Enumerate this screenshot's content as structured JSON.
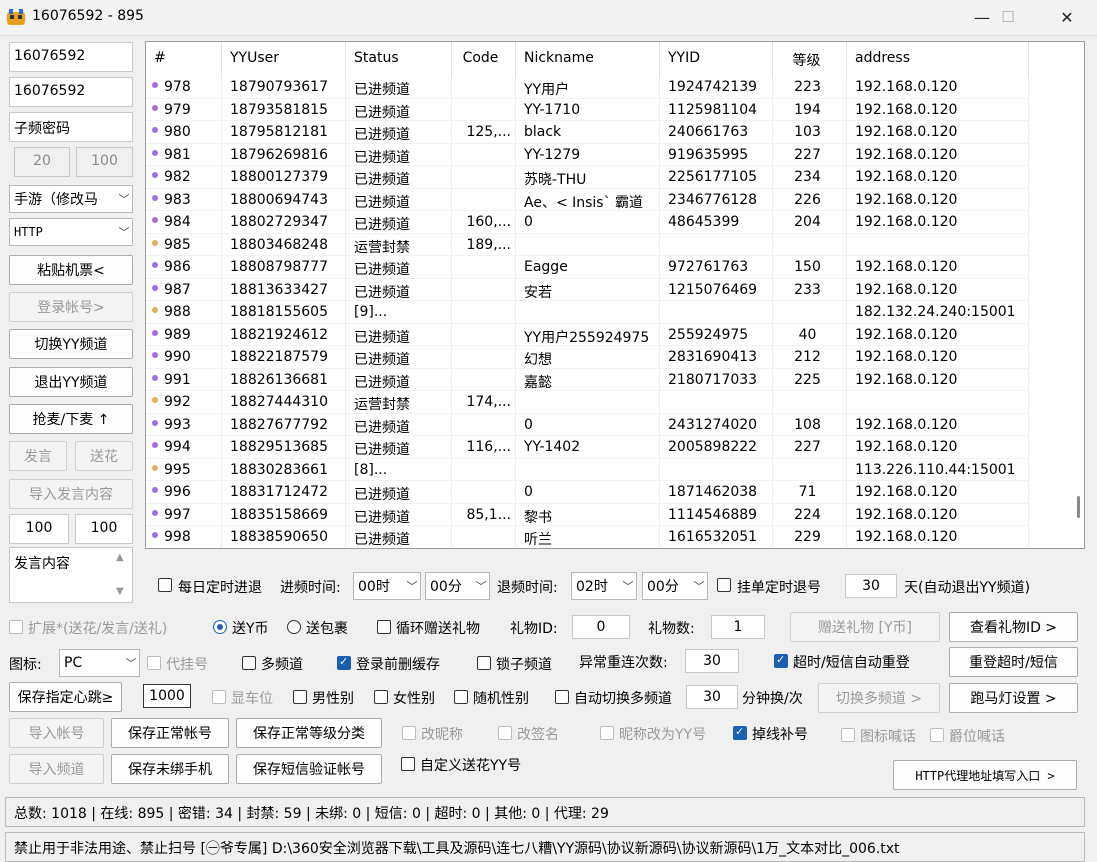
{
  "window": {
    "title": "16076592 - 895",
    "minimize": "—",
    "maximize": "☐",
    "close": "✕"
  },
  "left": {
    "field1": "16076592",
    "field2": "16076592",
    "subpwd": "子频密码",
    "n20": "20",
    "n100": "100",
    "game_select": "手游（修改马",
    "proto_select": "HTTP",
    "paste_ticket": "粘贴机票<",
    "login_account": "登录帐号>",
    "switch_channel": "切换YY频道",
    "exit_channel": "退出YY频道",
    "mic": "抢麦/下麦 ↑",
    "speak": "发言",
    "send_flower": "送花",
    "import_speech": "导入发言内容",
    "n100a": "100",
    "n100b": "100",
    "speech_content": "发言内容"
  },
  "table": {
    "headers": [
      "#",
      "YYUser",
      "Status",
      "Code",
      "Nickname",
      "YYID",
      "等级",
      "address"
    ],
    "rows": [
      {
        "n": "978",
        "user": "18790793617",
        "status": "已进频道",
        "code": "",
        "nick": "YY用户",
        "yyid": "1924742139",
        "lvl": "223",
        "addr": "192.168.0.120",
        "dot": "#a070e0"
      },
      {
        "n": "979",
        "user": "18793581815",
        "status": "已进频道",
        "code": "",
        "nick": "YY-1710",
        "yyid": "1125981104",
        "lvl": "194",
        "addr": "192.168.0.120",
        "dot": "#a070e0"
      },
      {
        "n": "980",
        "user": "18795812181",
        "status": "已进频道",
        "code": "125,...",
        "nick": "black",
        "yyid": "240661763",
        "lvl": "103",
        "addr": "192.168.0.120",
        "dot": "#a070e0"
      },
      {
        "n": "981",
        "user": "18796269816",
        "status": "已进频道",
        "code": "",
        "nick": "YY-1279",
        "yyid": "919635995",
        "lvl": "227",
        "addr": "192.168.0.120",
        "dot": "#a070e0"
      },
      {
        "n": "982",
        "user": "18800127379",
        "status": "已进频道",
        "code": "",
        "nick": "苏晓-THU",
        "yyid": "2256177105",
        "lvl": "234",
        "addr": "192.168.0.120",
        "dot": "#a070e0"
      },
      {
        "n": "983",
        "user": "18800694743",
        "status": "已进频道",
        "code": "",
        "nick": "Ae、< Insis` 霸道",
        "yyid": "2346776128",
        "lvl": "226",
        "addr": "192.168.0.120",
        "dot": "#a070e0"
      },
      {
        "n": "984",
        "user": "18802729347",
        "status": "已进频道",
        "code": "160,...",
        "nick": "0",
        "yyid": "48645399",
        "lvl": "204",
        "addr": "192.168.0.120",
        "dot": "#a070e0"
      },
      {
        "n": "985",
        "user": "18803468248",
        "status": "运营封禁",
        "code": "189,...",
        "nick": "",
        "yyid": "",
        "lvl": "",
        "addr": "",
        "dot": "#e0b060"
      },
      {
        "n": "986",
        "user": "18808798777",
        "status": "已进频道",
        "code": "",
        "nick": "Eagge",
        "yyid": "972761763",
        "lvl": "150",
        "addr": "192.168.0.120",
        "dot": "#a070e0"
      },
      {
        "n": "987",
        "user": "18813633427",
        "status": "已进频道",
        "code": "",
        "nick": "安若",
        "yyid": "1215076469",
        "lvl": "233",
        "addr": "192.168.0.120",
        "dot": "#a070e0"
      },
      {
        "n": "988",
        "user": "18818155605",
        "status": "[9]...",
        "code": "",
        "nick": "",
        "yyid": "",
        "lvl": "",
        "addr": "182.132.24.240:15001",
        "dot": "#e0b060"
      },
      {
        "n": "989",
        "user": "18821924612",
        "status": "已进频道",
        "code": "",
        "nick": "YY用户255924975",
        "yyid": "255924975",
        "lvl": "40",
        "addr": "192.168.0.120",
        "dot": "#a070e0"
      },
      {
        "n": "990",
        "user": "18822187579",
        "status": "已进频道",
        "code": "",
        "nick": "幻想",
        "yyid": "2831690413",
        "lvl": "212",
        "addr": "192.168.0.120",
        "dot": "#a070e0"
      },
      {
        "n": "991",
        "user": "18826136681",
        "status": "已进频道",
        "code": "",
        "nick": "嘉懿",
        "yyid": "2180717033",
        "lvl": "225",
        "addr": "192.168.0.120",
        "dot": "#a070e0"
      },
      {
        "n": "992",
        "user": "18827444310",
        "status": "运营封禁",
        "code": "174,...",
        "nick": "",
        "yyid": "",
        "lvl": "",
        "addr": "",
        "dot": "#e0b060"
      },
      {
        "n": "993",
        "user": "18827677792",
        "status": "已进频道",
        "code": "",
        "nick": "0",
        "yyid": "2431274020",
        "lvl": "108",
        "addr": "192.168.0.120",
        "dot": "#a070e0"
      },
      {
        "n": "994",
        "user": "18829513685",
        "status": "已进频道",
        "code": "116,...",
        "nick": "YY-1402",
        "yyid": "2005898222",
        "lvl": "227",
        "addr": "192.168.0.120",
        "dot": "#a070e0"
      },
      {
        "n": "995",
        "user": "18830283661",
        "status": "[8]...",
        "code": "",
        "nick": "",
        "yyid": "",
        "lvl": "",
        "addr": "113.226.110.44:15001",
        "dot": "#e0b060"
      },
      {
        "n": "996",
        "user": "18831712472",
        "status": "已进频道",
        "code": "",
        "nick": "0",
        "yyid": "1871462038",
        "lvl": "71",
        "addr": "192.168.0.120",
        "dot": "#a070e0"
      },
      {
        "n": "997",
        "user": "18835158669",
        "status": "已进频道",
        "code": "85,1...",
        "nick": "黎书",
        "yyid": "1114546889",
        "lvl": "224",
        "addr": "192.168.0.120",
        "dot": "#a070e0"
      },
      {
        "n": "998",
        "user": "18838590650",
        "status": "已进频道",
        "code": "",
        "nick": "听兰",
        "yyid": "1616532051",
        "lvl": "229",
        "addr": "192.168.0.120",
        "dot": "#a070e0"
      }
    ]
  },
  "timer": {
    "daily_label": "每日定时进退",
    "enter_label": "进频时间:",
    "enter_h": "00时",
    "enter_m": "00分",
    "exit_label": "退频时间:",
    "exit_h": "02时",
    "exit_m": "00分",
    "single_label": "挂单定时退号",
    "days": "30",
    "days_suffix": "天(自动退出YY频道)"
  },
  "gift": {
    "extend_label": "扩展*(送花/发言/送礼)",
    "send_coin": "送Y币",
    "send_pack": "送包裹",
    "loop_gift": "循环赠送礼物",
    "gift_id_label": "礼物ID:",
    "gift_id": "0",
    "gift_count_label": "礼物数:",
    "gift_count": "1",
    "give_btn": "赠送礼物 [Y币]",
    "view_id_btn": "查看礼物ID >"
  },
  "opts1": {
    "icon_label": "图标:",
    "icon_value": "PC",
    "proxy_hang": "代挂号",
    "multi_channel": "多频道",
    "login_cache": "登录前删缓存",
    "lock_channel": "锁子频道",
    "retry_label": "异常重连次数:",
    "retry": "30",
    "timeout_retry": "超时/短信自动重登",
    "relogin_btn": "重登超时/短信"
  },
  "opts2": {
    "save_heartbeat": "保存指定心跳≥",
    "heartbeat": "1000",
    "show_car": "显车位",
    "male": "男性别",
    "female": "女性别",
    "random_sex": "随机性别",
    "auto_switch": "自动切换多频道",
    "minutes": "30",
    "minutes_suffix": "分钟换/次",
    "switch_btn": "切换多频道 >",
    "marquee_btn": "跑马灯设置 >"
  },
  "opts3": {
    "import_account": "导入帐号",
    "save_normal": "保存正常帐号",
    "save_level": "保存正常等级分类",
    "rename": "改昵称",
    "resign": "改签名",
    "nick_to_yy": "昵称改为YY号",
    "reconnect": "掉线补号",
    "icon_call": "图标喊话",
    "rank_call": "爵位喊话"
  },
  "opts4": {
    "import_channel": "导入频道",
    "save_unbound": "保存未绑手机",
    "save_sms": "保存短信验证帐号",
    "custom_flower": "自定义送花YY号",
    "http_proxy_btn": "HTTP代理地址填写入口 >"
  },
  "status": {
    "text": "总数: 1018  |  在线: 895  |  密错: 34  |  封禁: 59  |  未绑: 0  |  短信: 0  |  超时: 0  |  其他: 0  |  代理: 29"
  },
  "path": {
    "text": "禁止用于非法用途、禁止扫号 [㊀爷专属]  D:\\360安全浏览器下载\\工具及源码\\连七八糟\\YY源码\\协议新源码\\协议新源码\\1万_文本对比_006.txt"
  }
}
